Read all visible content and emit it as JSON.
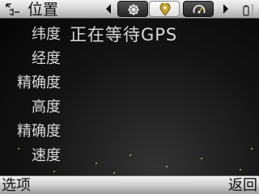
{
  "header": {
    "title": "位置",
    "back_icon": "back-arrow-icon",
    "tabs": [
      {
        "icon": "satellite-icon",
        "active": false
      },
      {
        "icon": "location-pin-icon",
        "active": true
      },
      {
        "icon": "speedometer-icon",
        "active": false
      }
    ],
    "status_icon": "battery-icon"
  },
  "fields": [
    {
      "label": "纬度",
      "value": "正在等待GPS"
    },
    {
      "label": "经度",
      "value": ""
    },
    {
      "label": "精确度",
      "value": ""
    },
    {
      "label": "高度",
      "value": ""
    },
    {
      "label": "精确度",
      "value": ""
    },
    {
      "label": "速度",
      "value": ""
    }
  ],
  "softkeys": {
    "left": "选项",
    "right": "返回"
  },
  "colors": {
    "background": "#0a0a0a",
    "text": "#d9d9d9",
    "bar": "#d9d9d9",
    "accent": "#c8a227"
  }
}
